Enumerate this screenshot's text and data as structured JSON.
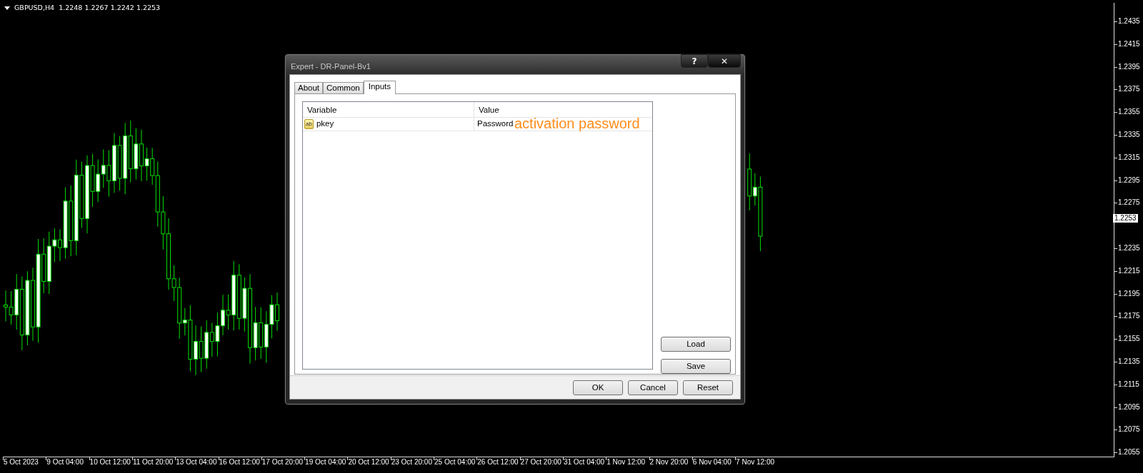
{
  "chart": {
    "symbol": "GBPUSD,H4",
    "ohlc": "1.2248 1.2267 1.2242 1.2253",
    "price_axis": [
      "1.2435",
      "1.2415",
      "1.2395",
      "1.2375",
      "1.2355",
      "1.2335",
      "1.2315",
      "1.2295",
      "1.2275",
      "1.2235",
      "1.2215",
      "1.2195",
      "1.2175",
      "1.2155",
      "1.2135",
      "1.2115",
      "1.2095",
      "1.2075",
      "1.2055"
    ],
    "current_price": "1.2253",
    "time_axis": [
      "5 Oct 2023",
      "9 Oct 04:00",
      "10 Oct 12:00",
      "11 Oct 20:00",
      "13 Oct 04:00",
      "16 Oct 12:00",
      "17 Oct 20:00",
      "19 Oct 04:00",
      "20 Oct 12:00",
      "23 Oct 20:00",
      "25 Oct 04:00",
      "26 Oct 12:00",
      "27 Oct 20:00",
      "31 Oct 04:00",
      "1 Nov 12:00",
      "2 Nov 20:00",
      "6 Nov 04:00",
      "7 Nov 12:00"
    ]
  },
  "dialog": {
    "title": "Expert - DR-Panel-Bv1",
    "title_buttons": [
      "?",
      "✕"
    ],
    "tabs": [
      {
        "label": "About",
        "selected": false
      },
      {
        "label": "Common",
        "selected": false
      },
      {
        "label": "Inputs",
        "selected": true
      }
    ],
    "table": {
      "columns": [
        "Variable",
        "Value"
      ],
      "rows": [
        {
          "icon_label": "ab",
          "variable": "pkey",
          "value": "Password"
        }
      ]
    },
    "annotation": {
      "text": "activation password",
      "color": "#ff8c1a"
    },
    "side_buttons": [
      "Load",
      "Save"
    ],
    "buttons": [
      "OK",
      "Cancel",
      "Reset"
    ]
  }
}
